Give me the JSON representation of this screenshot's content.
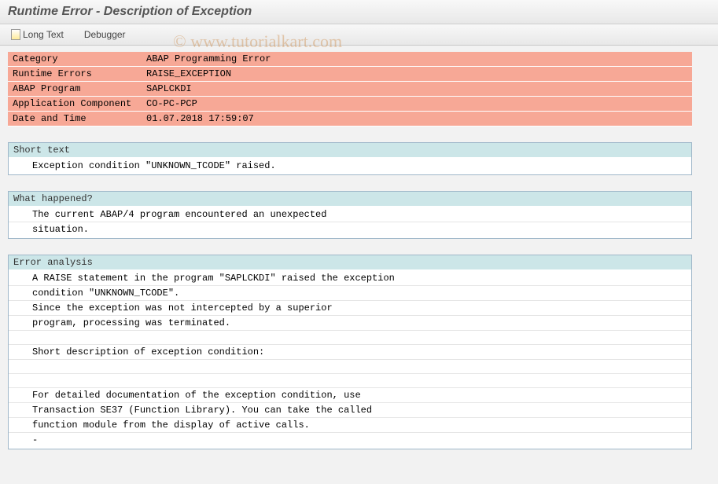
{
  "title": "Runtime Error - Description of Exception",
  "toolbar": {
    "long_text": "Long Text",
    "debugger": "Debugger"
  },
  "info": {
    "rows": [
      {
        "label": "Category",
        "value": "ABAP Programming Error"
      },
      {
        "label": "Runtime Errors",
        "value": "RAISE_EXCEPTION"
      },
      {
        "label": "ABAP Program",
        "value": "SAPLCKDI"
      },
      {
        "label": "Application Component",
        "value": "CO-PC-PCP"
      },
      {
        "label": "Date and Time",
        "value": "01.07.2018 17:59:07"
      }
    ]
  },
  "sections": [
    {
      "header": "Short text",
      "lines": [
        "Exception condition \"UNKNOWN_TCODE\" raised."
      ]
    },
    {
      "header": "What happened?",
      "lines": [
        "The current ABAP/4 program encountered an unexpected",
        "situation."
      ]
    },
    {
      "header": "Error analysis",
      "lines": [
        "A RAISE statement in the program \"SAPLCKDI\" raised the exception",
        "condition \"UNKNOWN_TCODE\".",
        "Since the exception was not intercepted by a superior",
        "program, processing was terminated.",
        "",
        "Short description of exception condition:",
        "",
        "",
        "For detailed documentation of the exception condition, use",
        "Transaction SE37 (Function Library). You can take the called",
        "function module from the display of active calls.",
        "-"
      ]
    }
  ],
  "watermark": "© www.tutorialkart.com"
}
